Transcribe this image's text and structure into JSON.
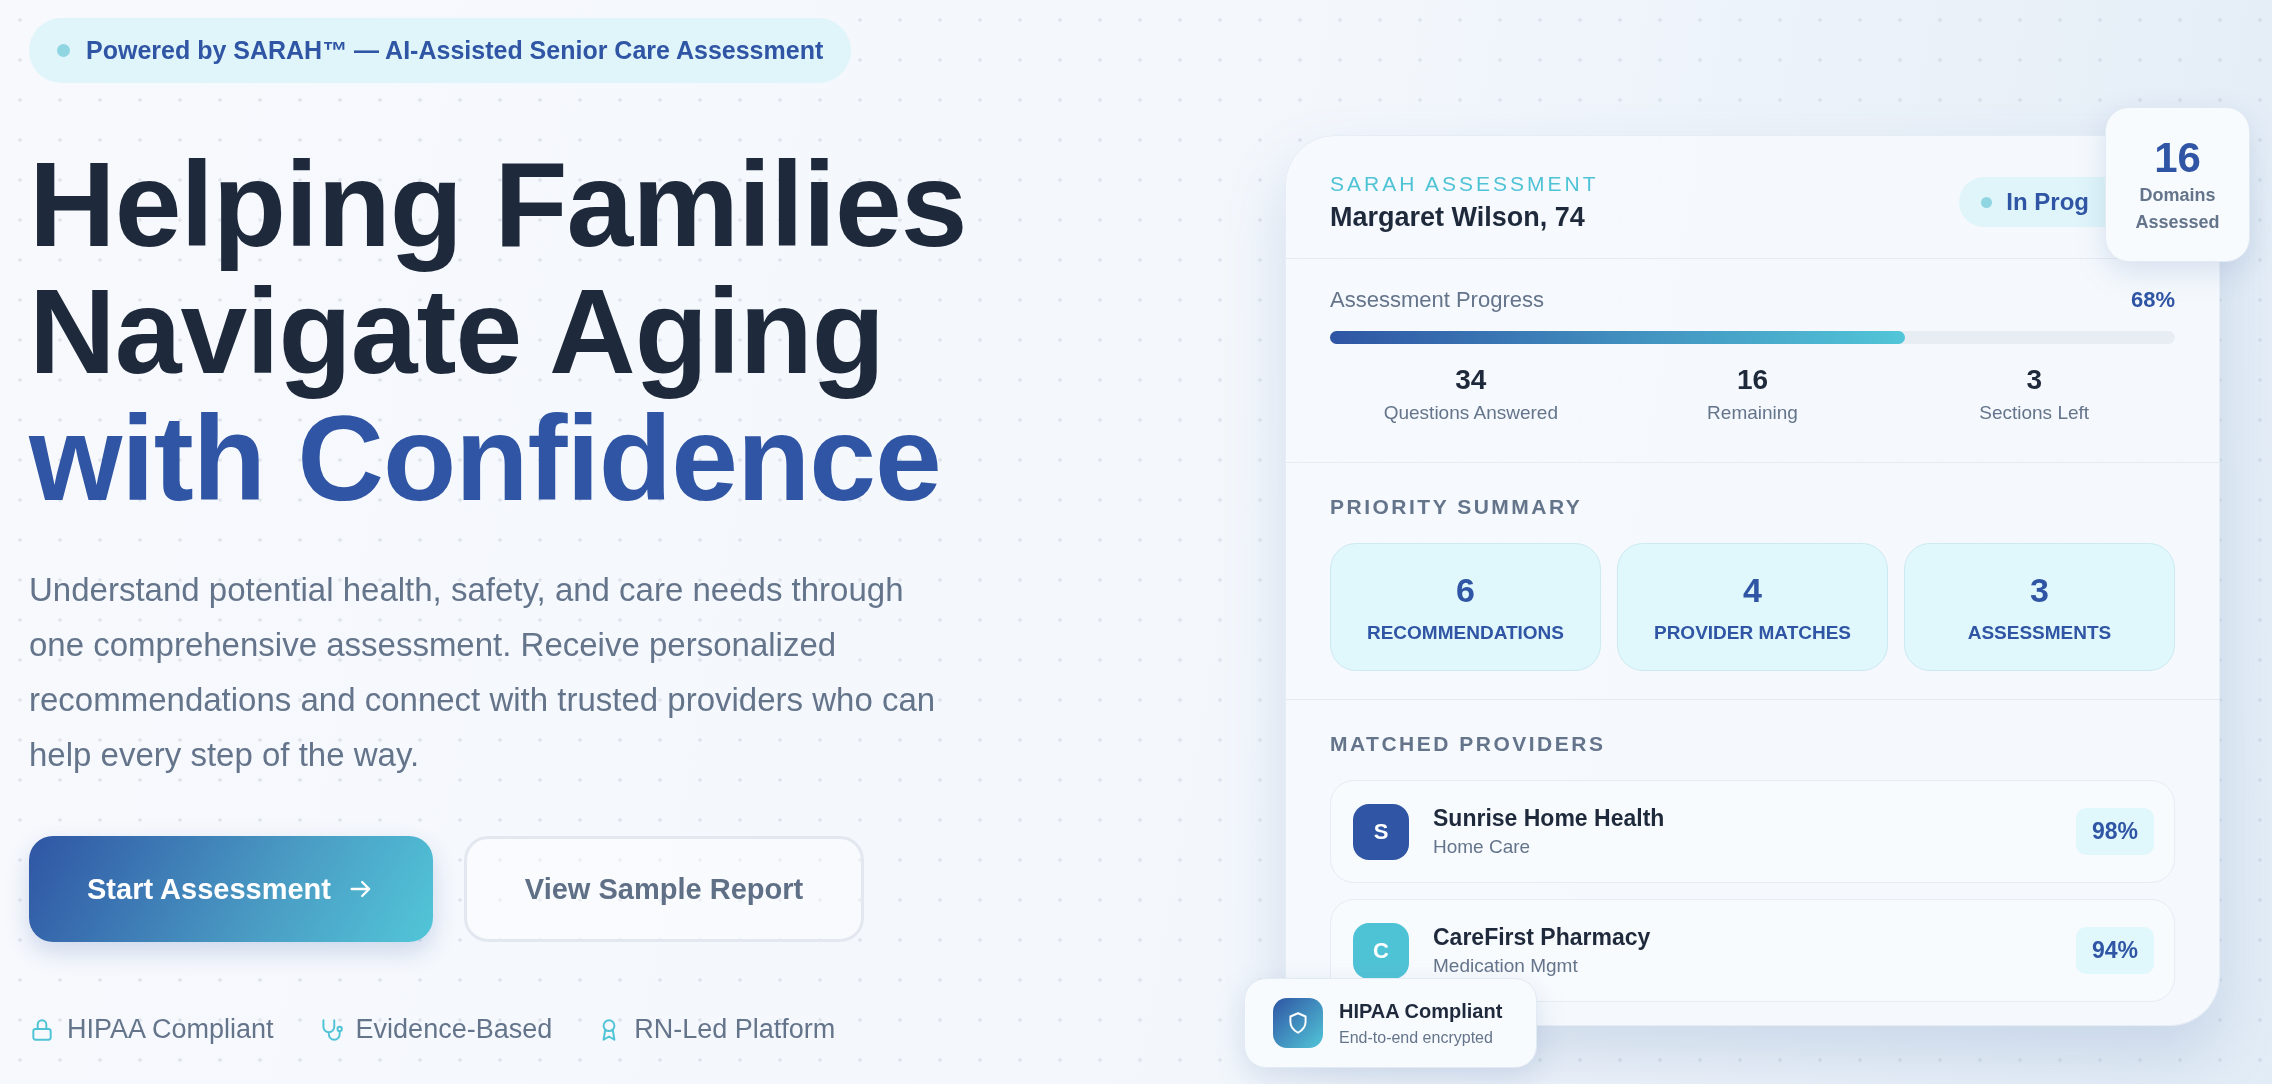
{
  "badge": {
    "text": "Powered by SARAH™ — AI-Assisted Senior Care Assessment"
  },
  "headline": [
    {
      "text": "Helping Families",
      "accent": false
    },
    {
      "text": "Navigate Aging",
      "accent": false
    },
    {
      "text": "with Confidence",
      "accent": true
    }
  ],
  "description": "Understand potential health, safety, and care needs through one comprehensive assessment. Receive personalized recommendations and connect with trusted providers who can help every step of the way.",
  "buttons": [
    {
      "label": "Start Assessment",
      "kind": "primary"
    },
    {
      "label": "View Sample Report",
      "kind": "secondary"
    }
  ],
  "features": [
    {
      "label": "HIPAA Compliant",
      "kind": "lock"
    },
    {
      "label": "Evidence-Based",
      "kind": "stethoscope"
    },
    {
      "label": "RN-Led Platform",
      "kind": "award"
    }
  ],
  "card": {
    "eyebrow": "SARAH ASSESSMENT",
    "name": "Margaret Wilson, 74",
    "status": "In Prog",
    "progress": {
      "label": "Assessment Progress",
      "value": "68%",
      "level": 0.68
    },
    "stats": [
      {
        "value": "34",
        "label": "Questions Answered"
      },
      {
        "value": "16",
        "label": "Remaining"
      },
      {
        "value": "3",
        "label": "Sections Left"
      }
    ],
    "priority_title": "PRIORITY SUMMARY",
    "priorities": [
      {
        "value": "6",
        "label": "RECOMMENDATIONS"
      },
      {
        "value": "4",
        "label": "PROVIDER MATCHES"
      },
      {
        "value": "3",
        "label": "ASSESSMENTS"
      }
    ],
    "providers_title": "MATCHED PROVIDERS",
    "providers": [
      {
        "initial": "S",
        "name": "Sunrise Home Health",
        "type": "Home Care",
        "match": "98%",
        "color": "#2f55a4"
      },
      {
        "initial": "C",
        "name": "CareFirst Pharmacy",
        "type": "Medication Mgmt",
        "match": "94%",
        "color": "#4fc3d6"
      }
    ]
  },
  "domains_badge": {
    "value": "16",
    "label": "Domains Assessed"
  },
  "hipaa_badge": {
    "title": "HIPAA Compliant",
    "subtitle": "End-to-end encrypted"
  }
}
